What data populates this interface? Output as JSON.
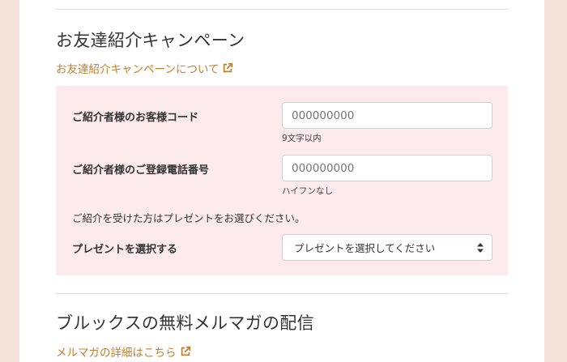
{
  "referral": {
    "heading": "お友達紹介キャンペーン",
    "about_link": "お友達紹介キャンペーンについて",
    "customer_code": {
      "label": "ご紹介者様のお客様コード",
      "placeholder": "000000000",
      "help": "9文字以内"
    },
    "phone": {
      "label": "ご紹介者様のご登録電話番号",
      "placeholder": "000000000",
      "help": "ハイフンなし"
    },
    "note": "ご紹介を受けた方はプレゼントをお選びください。",
    "present": {
      "label": "プレゼントを選択する",
      "selected": "プレゼントを選択してください"
    }
  },
  "newsletter": {
    "heading": "ブルックスの無料メルマガの配信",
    "details_link": "メルマガの詳細はこちら"
  },
  "colors": {
    "accent": "#c08030",
    "form_bg": "#fdeaec",
    "page_bg": "#f6e4dc"
  }
}
